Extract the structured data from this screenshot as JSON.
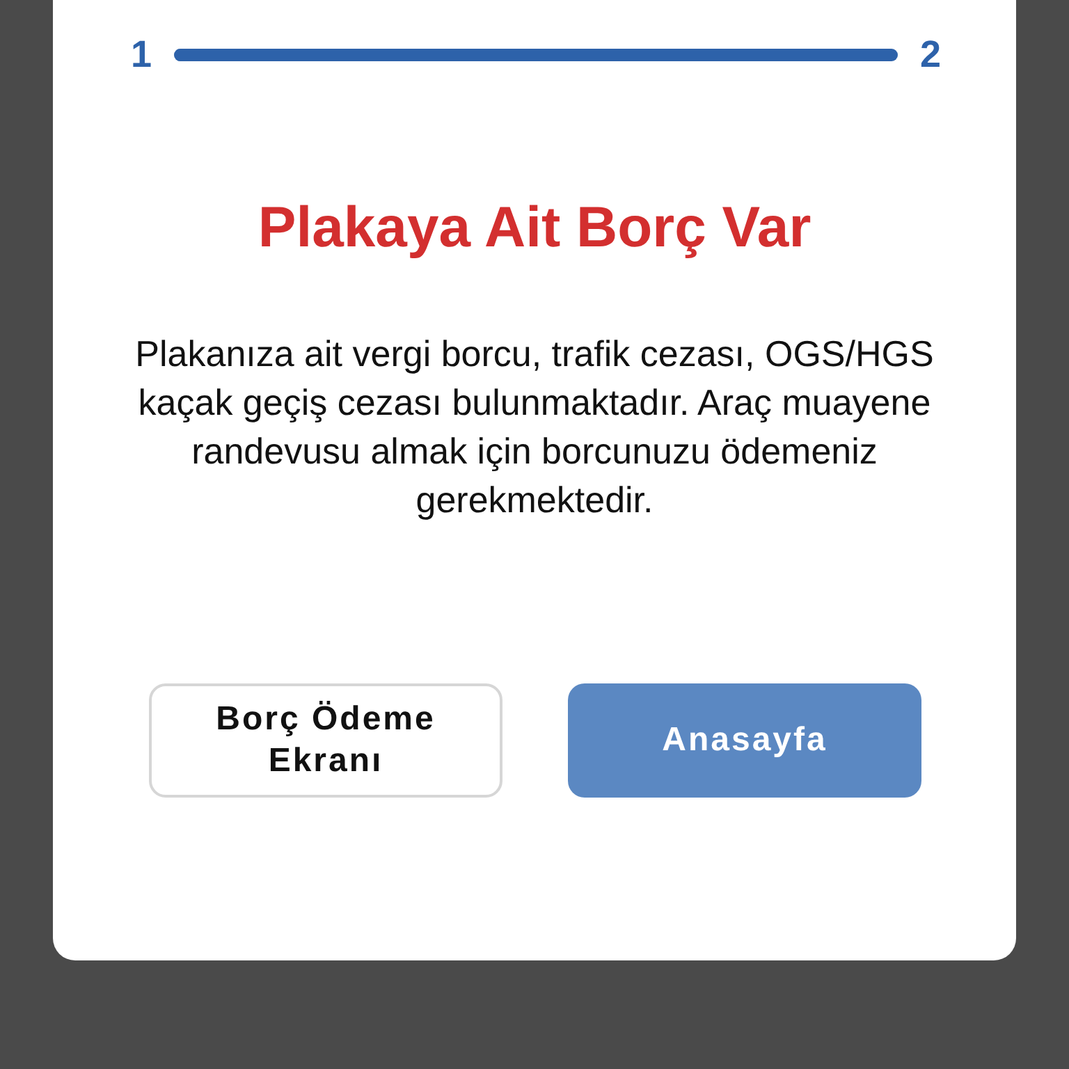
{
  "progress": {
    "start_label": "1",
    "end_label": "2",
    "level": 1
  },
  "title": "Plakaya Ait Borç Var",
  "message": "Plakanıza ait vergi borcu, trafik cezası, OGS/HGS kaçak geçiş cezası bulunmaktadır. Araç muayene randevusu almak için borcunuzu ödemeniz gerekmektedir.",
  "buttons": [
    {
      "label": "Borç Ödeme Ekranı",
      "kind": "outline"
    },
    {
      "label": "Anasayfa",
      "kind": "filled"
    }
  ]
}
